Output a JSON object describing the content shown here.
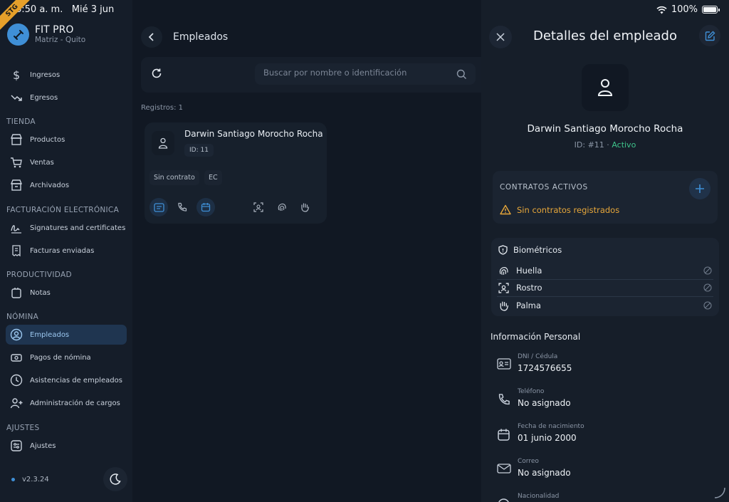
{
  "status_bar": {
    "time": "6:50 a. m.",
    "date": "Mié 3 jun",
    "battery": "100%",
    "env_badge": "STG",
    "battery_level": 1.0
  },
  "brand": {
    "name": "FIT PRO",
    "subtitle": "Matriz - Quito"
  },
  "sidebar": {
    "items": [
      {
        "label": "Ingresos",
        "icon": "dollar-icon"
      },
      {
        "label": "Egresos",
        "icon": "trend-down-icon"
      },
      {
        "label": "Productos",
        "icon": "store-icon"
      },
      {
        "label": "Ventas",
        "icon": "cart-icon"
      },
      {
        "label": "Archivados",
        "icon": "archive-store-icon"
      },
      {
        "label": "Signatures and certificates",
        "icon": "signature-icon"
      },
      {
        "label": "Facturas enviadas",
        "icon": "receipt-icon"
      },
      {
        "label": "Notas",
        "icon": "notes-icon"
      },
      {
        "label": "Empleados",
        "icon": "user-circle-icon",
        "active": true
      },
      {
        "label": "Pagos de nómina",
        "icon": "payment-icon"
      },
      {
        "label": "Asistencias de empleados",
        "icon": "clock-icon"
      },
      {
        "label": "Administración de cargos",
        "icon": "user-plus-icon"
      },
      {
        "label": "Ajustes",
        "icon": "settings-icon"
      }
    ],
    "sections": {
      "tienda": "TIENDA",
      "facturacion": "FACTURACIÓN ELECTRÓNICA",
      "productividad": "PRODUCTIVIDAD",
      "nomina": "NÓMINA",
      "ajustes": "AJUSTES"
    },
    "version": "v2.3.24",
    "accent": "#3f8fd6"
  },
  "main": {
    "title": "Empleados",
    "search_placeholder": "Buscar por nombre o identificación",
    "records": "Registros: 1",
    "employee": {
      "name": "Darwin Santiago Morocho Rocha",
      "id": "ID: 11",
      "chips": [
        "Sin contrato",
        "EC"
      ]
    }
  },
  "panel": {
    "title": "Detalles del empleado",
    "name": "Darwin Santiago Morocho Rocha",
    "id_prefix": "ID: #11",
    "separator": " · ",
    "status": "Activo",
    "status_color": "#3ec38a",
    "contracts_title": "CONTRATOS ACTIVOS",
    "contracts_empty": "Sin contratos registrados",
    "warning_color": "#e7a73a",
    "biometrics_title": "Biométricos",
    "biometrics": [
      {
        "label": "Huella",
        "icon": "fingerprint-icon"
      },
      {
        "label": "Rostro",
        "icon": "face-scan-icon"
      },
      {
        "label": "Palma",
        "icon": "palm-icon"
      }
    ],
    "info_title": "Información Personal",
    "info": [
      {
        "label": "DNI / Cédula",
        "value": "1724576655",
        "icon": "id-card-icon"
      },
      {
        "label": "Teléfono",
        "value": "No asignado",
        "icon": "phone-icon"
      },
      {
        "label": "Fecha de nacimiento",
        "value": "01 junio 2000",
        "icon": "calendar-icon"
      },
      {
        "label": "Correo",
        "value": "No asignado",
        "icon": "mail-icon"
      },
      {
        "label": "Nacionalidad",
        "value": "",
        "icon": "globe-icon"
      }
    ]
  }
}
